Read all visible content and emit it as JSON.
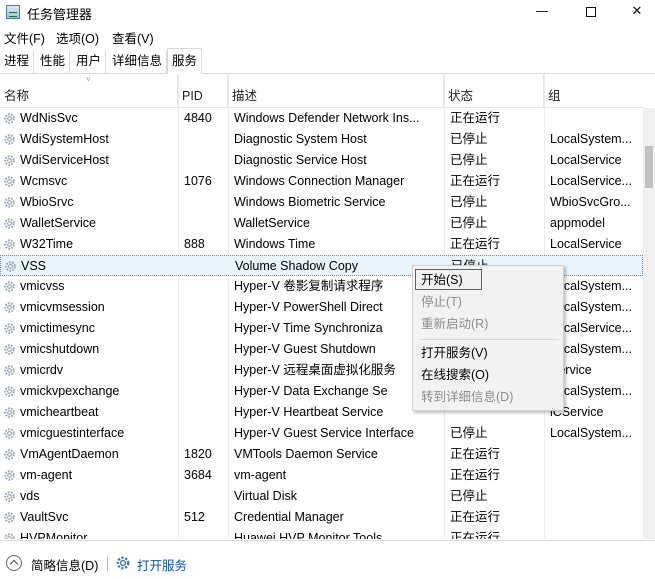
{
  "window": {
    "title": "任务管理器"
  },
  "menu": [
    "文件(F)",
    "选项(O)",
    "查看(V)"
  ],
  "tabs": [
    "进程",
    "性能",
    "用户",
    "详细信息",
    "服务"
  ],
  "active_tab": "服务",
  "columns": {
    "name": "名称",
    "pid": "PID",
    "desc": "描述",
    "status": "状态",
    "group": "组"
  },
  "rows": [
    {
      "name": "WdNisSvc",
      "pid": "4840",
      "desc": "Windows Defender Network Ins...",
      "status": "正在运行",
      "group": ""
    },
    {
      "name": "WdiSystemHost",
      "pid": "",
      "desc": "Diagnostic System Host",
      "status": "已停止",
      "group": "LocalSystem..."
    },
    {
      "name": "WdiServiceHost",
      "pid": "",
      "desc": "Diagnostic Service Host",
      "status": "已停止",
      "group": "LocalService"
    },
    {
      "name": "Wcmsvc",
      "pid": "1076",
      "desc": "Windows Connection Manager",
      "status": "正在运行",
      "group": "LocalService..."
    },
    {
      "name": "WbioSrvc",
      "pid": "",
      "desc": "Windows Biometric Service",
      "status": "已停止",
      "group": "WbioSvcGro..."
    },
    {
      "name": "WalletService",
      "pid": "",
      "desc": "WalletService",
      "status": "已停止",
      "group": "appmodel"
    },
    {
      "name": "W32Time",
      "pid": "888",
      "desc": "Windows Time",
      "status": "正在运行",
      "group": "LocalService"
    },
    {
      "name": "VSS",
      "pid": "",
      "desc": "Volume Shadow Copy",
      "status": "已停止",
      "group": ""
    },
    {
      "name": "vmicvss",
      "pid": "",
      "desc": "Hyper-V 卷影复制请求程序",
      "status": "",
      "group": "LocalSystem..."
    },
    {
      "name": "vmicvmsession",
      "pid": "",
      "desc": "Hyper-V PowerShell Direct",
      "status": "",
      "group": "LocalSystem..."
    },
    {
      "name": "vmictimesync",
      "pid": "",
      "desc": "Hyper-V Time Synchroniza",
      "status": "",
      "group": "LocalService..."
    },
    {
      "name": "vmicshutdown",
      "pid": "",
      "desc": "Hyper-V Guest Shutdown",
      "status": "",
      "group": "LocalSystem..."
    },
    {
      "name": "vmicrdv",
      "pid": "",
      "desc": "Hyper-V 远程桌面虚拟化服务",
      "status": "",
      "group": "Service"
    },
    {
      "name": "vmickvpexchange",
      "pid": "",
      "desc": "Hyper-V Data Exchange Se",
      "status": "",
      "group": "LocalSystem..."
    },
    {
      "name": "vmicheartbeat",
      "pid": "",
      "desc": "Hyper-V Heartbeat Service",
      "status": "",
      "group": "lCService"
    },
    {
      "name": "vmicguestinterface",
      "pid": "",
      "desc": "Hyper-V Guest Service Interface",
      "status": "已停止",
      "group": "LocalSystem..."
    },
    {
      "name": "VmAgentDaemon",
      "pid": "1820",
      "desc": "VMTools Daemon Service",
      "status": "正在运行",
      "group": ""
    },
    {
      "name": "vm-agent",
      "pid": "3684",
      "desc": "vm-agent",
      "status": "正在运行",
      "group": ""
    },
    {
      "name": "vds",
      "pid": "",
      "desc": "Virtual Disk",
      "status": "已停止",
      "group": ""
    },
    {
      "name": "VaultSvc",
      "pid": "512",
      "desc": "Credential Manager",
      "status": "正在运行",
      "group": ""
    },
    {
      "name": "HVPMonitor",
      "pid": "",
      "desc": "Huawei HVP Monitor Tools",
      "status": "正在运行",
      "group": ""
    }
  ],
  "selected_row": "VSS",
  "context_menu": [
    "开始(S)",
    "停止(T)",
    "重新启动(R)",
    "打开服务(V)",
    "在线搜索(O)",
    "转到详细信息(D)"
  ],
  "footer": {
    "brief": "简略信息(D)",
    "open_services": "打开服务"
  },
  "colors": {
    "selection": "#eaf4fd",
    "highlight_border": "#d42e2e",
    "link": "#0d55b0"
  }
}
